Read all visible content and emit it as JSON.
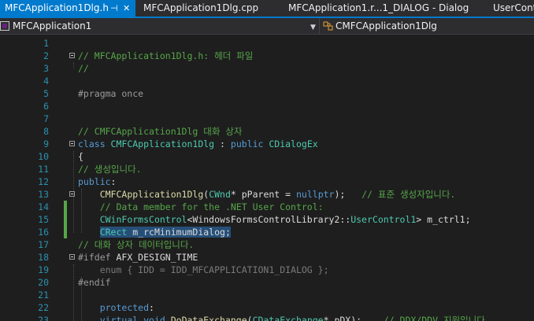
{
  "tabs": [
    {
      "label": "MFCApplication1Dlg.h",
      "active": true,
      "pin": "⊣",
      "close": "✕"
    },
    {
      "label": "MFCApplication1Dlg.cpp",
      "active": false
    },
    {
      "label": "MFCApplication1.r...1_DIALOG - Dialog",
      "active": false
    },
    {
      "label": "UserControl",
      "active": false
    }
  ],
  "navbar": {
    "project": "MFCApplication1",
    "scope": "CMFCApplication1Dlg"
  },
  "colors": {
    "accent": "#007acc",
    "line_number": "#2b91af",
    "keyword": "#569cd6",
    "comment": "#57a64a",
    "type": "#4ec9b0",
    "change_bar": "#57a64a"
  },
  "lines": [
    {
      "n": "1",
      "tokens": []
    },
    {
      "n": "2",
      "fold": true,
      "tokens": [
        {
          "t": "// MFCApplication1Dlg.h: 헤더 파일",
          "c": "cm"
        }
      ]
    },
    {
      "n": "3",
      "tokens": [
        {
          "t": "//",
          "c": "cm"
        }
      ]
    },
    {
      "n": "4",
      "tokens": []
    },
    {
      "n": "5",
      "tokens": [
        {
          "t": "#pragma once",
          "c": "pp"
        }
      ]
    },
    {
      "n": "6",
      "tokens": []
    },
    {
      "n": "7",
      "tokens": []
    },
    {
      "n": "8",
      "tokens": [
        {
          "t": "// CMFCApplication1Dlg 대화 상자",
          "c": "cm"
        }
      ]
    },
    {
      "n": "9",
      "fold": true,
      "tokens": [
        {
          "t": "class ",
          "c": "kw"
        },
        {
          "t": "CMFCApplication1Dlg",
          "c": "ty"
        },
        {
          "t": " : ",
          "c": "pl"
        },
        {
          "t": "public ",
          "c": "kw"
        },
        {
          "t": "CDialogEx",
          "c": "ty"
        }
      ]
    },
    {
      "n": "10",
      "tokens": [
        {
          "t": "{",
          "c": "pl"
        }
      ]
    },
    {
      "n": "11",
      "tokens": [
        {
          "t": "// 생성입니다.",
          "c": "cm"
        }
      ]
    },
    {
      "n": "12",
      "tokens": [
        {
          "t": "public",
          "c": "kw"
        },
        {
          "t": ":",
          "c": "pl"
        }
      ]
    },
    {
      "n": "13",
      "fold": true,
      "tokens": [
        {
          "t": "    ",
          "c": "pl"
        },
        {
          "t": "CMFCApplication1Dlg",
          "c": "fn"
        },
        {
          "t": "(",
          "c": "pl"
        },
        {
          "t": "CWnd",
          "c": "ty"
        },
        {
          "t": "* pParent = ",
          "c": "pl"
        },
        {
          "t": "nullptr",
          "c": "kw"
        },
        {
          "t": ");   ",
          "c": "pl"
        },
        {
          "t": "// 표준 생성자입니다.",
          "c": "cm"
        }
      ]
    },
    {
      "n": "14",
      "changed": true,
      "tokens": [
        {
          "t": "    ",
          "c": "pl"
        },
        {
          "t": "// Data member for the .NET User Control:",
          "c": "cm"
        }
      ]
    },
    {
      "n": "15",
      "changed": true,
      "tokens": [
        {
          "t": "    ",
          "c": "pl"
        },
        {
          "t": "CWinFormsControl",
          "c": "ty"
        },
        {
          "t": "<WindowsFormsControlLibrary2::",
          "c": "pl"
        },
        {
          "t": "UserControl1",
          "c": "ty"
        },
        {
          "t": "> m_ctrl1;",
          "c": "pl"
        }
      ]
    },
    {
      "n": "16",
      "changed": true,
      "tokens": [
        {
          "t": "    ",
          "c": "pl"
        },
        {
          "t": "CRect",
          "c": "ty",
          "sel": true
        },
        {
          "t": " m_rcMinimumDialog;",
          "c": "pl",
          "sel": true
        }
      ]
    },
    {
      "n": "17",
      "tokens": [
        {
          "t": "// 대화 상자 데이터입니다.",
          "c": "cm"
        }
      ]
    },
    {
      "n": "18",
      "fold": true,
      "tokens": [
        {
          "t": "#ifdef ",
          "c": "pp"
        },
        {
          "t": "AFX_DESIGN_TIME",
          "c": "pl"
        }
      ]
    },
    {
      "n": "19",
      "tokens": [
        {
          "t": "    ",
          "c": "pl"
        },
        {
          "t": "enum",
          "c": "inact"
        },
        {
          "t": " { IDD = IDD_MFCAPPLICATION1_DIALOG };",
          "c": "inact"
        }
      ]
    },
    {
      "n": "20",
      "tokens": [
        {
          "t": "#endif",
          "c": "pp"
        }
      ]
    },
    {
      "n": "21",
      "tokens": []
    },
    {
      "n": "22",
      "tokens": [
        {
          "t": "    ",
          "c": "pl"
        },
        {
          "t": "protected",
          "c": "kw"
        },
        {
          "t": ":",
          "c": "pl"
        }
      ]
    },
    {
      "n": "23",
      "tokens": [
        {
          "t": "    ",
          "c": "pl"
        },
        {
          "t": "virtual ",
          "c": "kw"
        },
        {
          "t": "void ",
          "c": "kw"
        },
        {
          "t": "DoDataExchange",
          "c": "fn"
        },
        {
          "t": "(",
          "c": "pl"
        },
        {
          "t": "CDataExchange",
          "c": "ty"
        },
        {
          "t": "* pDX);    ",
          "c": "pl"
        },
        {
          "t": "// DDX/DDV 지원입니다.",
          "c": "cm"
        }
      ]
    }
  ]
}
